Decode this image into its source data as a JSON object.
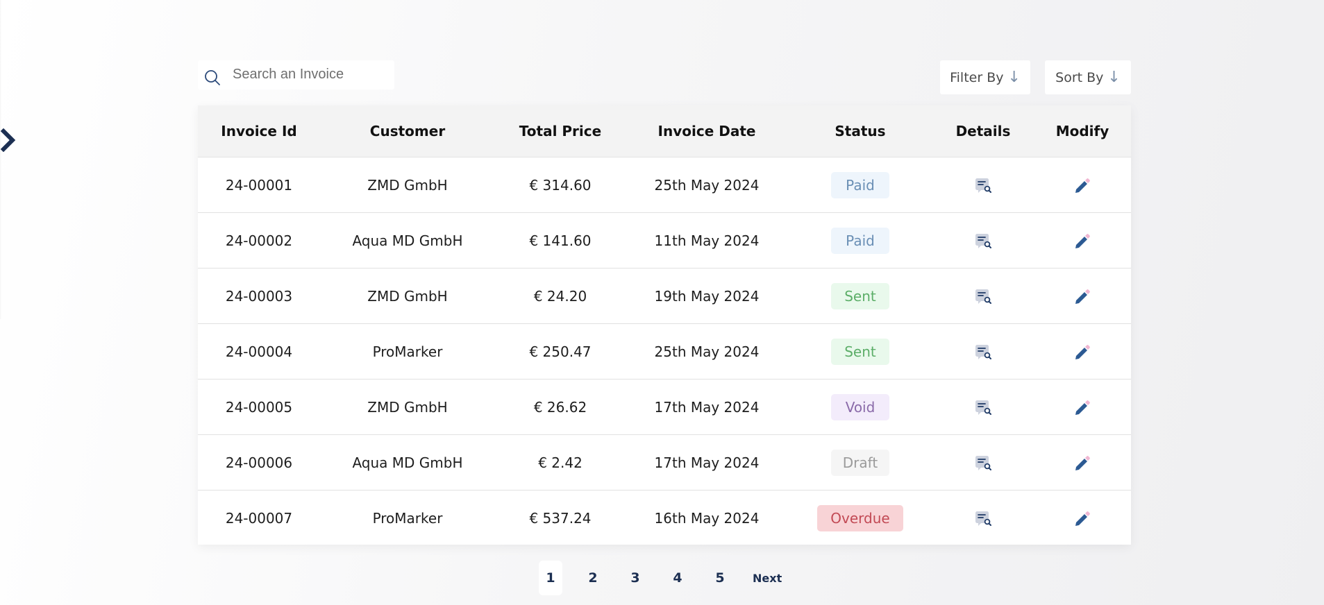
{
  "search": {
    "placeholder": "Search an Invoice"
  },
  "toolbar": {
    "filter_label": "Filter By",
    "sort_label": "Sort By",
    "arrow": "↓"
  },
  "table": {
    "headers": [
      "Invoice Id",
      "Customer",
      "Total Price",
      "Invoice Date",
      "Status",
      "Details",
      "Modify"
    ],
    "rows": [
      {
        "id": "24-00001",
        "customer": "ZMD GmbH",
        "total": "€ 314.60",
        "date": "25th May 2024",
        "status": "Paid"
      },
      {
        "id": "24-00002",
        "customer": "Aqua MD GmbH",
        "total": "€ 141.60",
        "date": "11th May 2024",
        "status": "Paid"
      },
      {
        "id": "24-00003",
        "customer": "ZMD GmbH",
        "total": "€ 24.20",
        "date": "19th May 2024",
        "status": "Sent"
      },
      {
        "id": "24-00004",
        "customer": "ProMarker",
        "total": "€ 250.47",
        "date": "25th May 2024",
        "status": "Sent"
      },
      {
        "id": "24-00005",
        "customer": "ZMD GmbH",
        "total": "€ 26.62",
        "date": "17th May 2024",
        "status": "Void"
      },
      {
        "id": "24-00006",
        "customer": "Aqua MD GmbH",
        "total": "€ 2.42",
        "date": "17th May 2024",
        "status": "Draft"
      },
      {
        "id": "24-00007",
        "customer": "ProMarker",
        "total": "€ 537.24",
        "date": "16th May 2024",
        "status": "Overdue"
      }
    ]
  },
  "status_colors": {
    "Paid": {
      "bg": "#eef5fc",
      "fg": "#6a8fb5"
    },
    "Sent": {
      "bg": "#e9f9ec",
      "fg": "#5cae68"
    },
    "Void": {
      "bg": "#f3ecfb",
      "fg": "#8a6aa9"
    },
    "Draft": {
      "bg": "#f5f5f5",
      "fg": "#9a9a9a"
    },
    "Overdue": {
      "bg": "#f8d3d6",
      "fg": "#c24a55"
    }
  },
  "icons": {
    "details": "document-search-icon",
    "modify": "pencil-icon",
    "search": "search-icon",
    "sidebar": "chevron-right-icon"
  },
  "pagination": {
    "pages": [
      "1",
      "2",
      "3",
      "4",
      "5"
    ],
    "current": "1",
    "next_label": "Next"
  },
  "colors": {
    "accent": "#1c2f52",
    "icon_blue": "#2c5a93"
  }
}
